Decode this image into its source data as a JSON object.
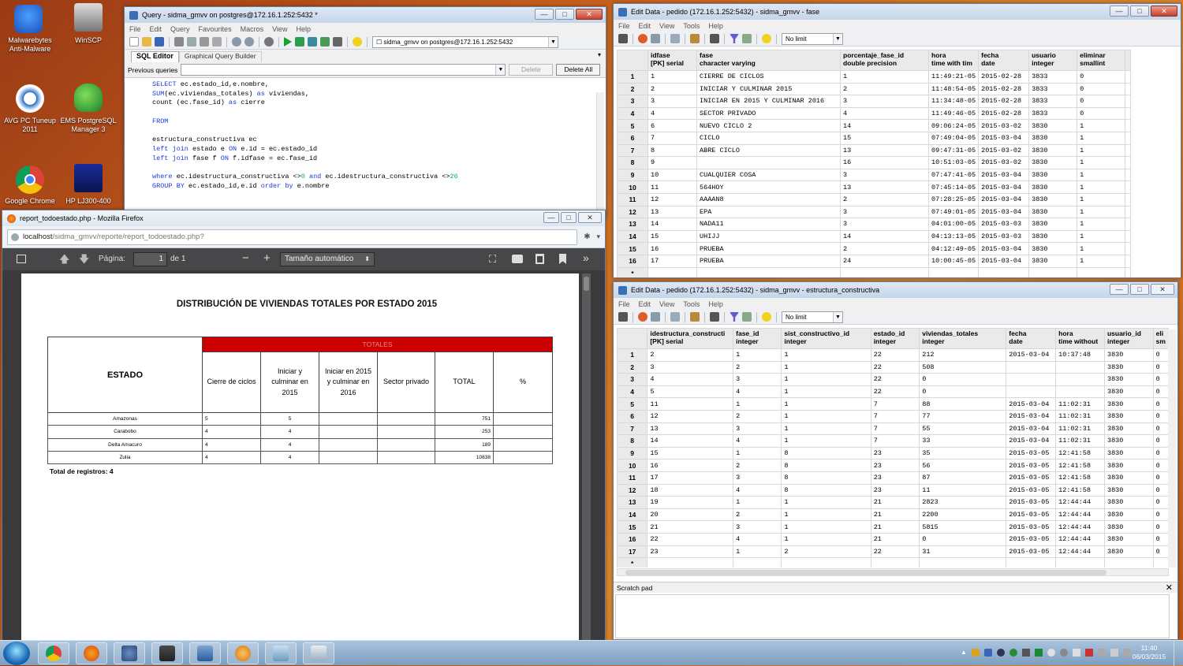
{
  "desktop": {
    "icons": [
      {
        "label": "Malwarebytes Anti-Malware",
        "icon": "malwarebytes-icon"
      },
      {
        "label": "WinSCP",
        "icon": "winscp-icon"
      },
      {
        "label": "AVG PC Tuneup 2011",
        "icon": "avg-icon"
      },
      {
        "label": "EMS PostgreSQL Manager 3",
        "icon": "ems-icon"
      },
      {
        "label": "Google Chrome",
        "icon": "chrome-icon"
      },
      {
        "label": "HP LJ300-400",
        "icon": "printer-icon"
      }
    ]
  },
  "query_window": {
    "title": "Query - sidma_gmvv on postgres@172.16.1.252:5432 *",
    "menu": [
      "File",
      "Edit",
      "Query",
      "Favourites",
      "Macros",
      "View",
      "Help"
    ],
    "connection": "sidma_gmvv on postgres@172.16.1.252:5432",
    "tabs": [
      "SQL Editor",
      "Graphical Query Builder"
    ],
    "previous_queries_label": "Previous queries",
    "delete_label": "Delete",
    "delete_all_label": "Delete All",
    "sql_lines": [
      [
        {
          "t": "SELECT ",
          "c": "kw"
        },
        {
          "t": "ec.estado_id,e.nombre,"
        }
      ],
      [
        {
          "t": "SUM",
          "c": "kw"
        },
        {
          "t": "(ec.viviendas_totales) "
        },
        {
          "t": "as",
          "c": "kw"
        },
        {
          "t": " viviendas,"
        }
      ],
      [
        {
          "t": "count (ec.fase_id) "
        },
        {
          "t": "as",
          "c": "kw"
        },
        {
          "t": " cierre"
        }
      ],
      [
        {
          "t": ""
        }
      ],
      [
        {
          "t": "FROM",
          "c": "kw"
        }
      ],
      [
        {
          "t": ""
        }
      ],
      [
        {
          "t": "estructura_constructiva ec"
        }
      ],
      [
        {
          "t": "left join",
          "c": "kw"
        },
        {
          "t": " estado e "
        },
        {
          "t": "ON",
          "c": "kw"
        },
        {
          "t": " e.id = ec.estado_id"
        }
      ],
      [
        {
          "t": "left join",
          "c": "kw"
        },
        {
          "t": " fase f "
        },
        {
          "t": "ON",
          "c": "kw"
        },
        {
          "t": " f.idfase = ec.fase_id"
        }
      ],
      [
        {
          "t": ""
        }
      ],
      [
        {
          "t": "where",
          "c": "kw"
        },
        {
          "t": " ec.idestructura_constructiva <>"
        },
        {
          "t": "0",
          "c": "num"
        },
        {
          "t": " "
        },
        {
          "t": "and",
          "c": "kw"
        },
        {
          "t": " ec.idestructura_constructiva <>"
        },
        {
          "t": "26",
          "c": "num"
        }
      ],
      [
        {
          "t": "GROUP BY",
          "c": "kw"
        },
        {
          "t": " ec.estado_id,e.id "
        },
        {
          "t": "order by",
          "c": "kw"
        },
        {
          "t": " e.nombre"
        }
      ]
    ]
  },
  "firefox": {
    "title": "report_todoestado.php - Mozilla Firefox",
    "url_host": "localhost",
    "url_path": "/sidma_gmvv/reporte/report_todoestado.php?",
    "page_label": "Página:",
    "page_value": "1",
    "page_of": "de 1",
    "zoom": "Tamaño automático",
    "report": {
      "title": "DISTRIBUCIÓN DE VIVIENDAS TOTALES POR ESTADO 2015",
      "estado_header": "ESTADO",
      "totales_header": "TOTALES",
      "columns": [
        "Cierre de ciclos",
        "Iniciar y culminar en 2015",
        "Iniciar en 2015 y culminar en 2016",
        "Sector privado",
        "TOTAL",
        "%"
      ],
      "rows": [
        {
          "estado": "Amazonas",
          "cierre": "5",
          "iniciar": "5",
          "i2016": "",
          "privado": "",
          "total": "751",
          "pct": ""
        },
        {
          "estado": "Carabobo",
          "cierre": "4",
          "iniciar": "4",
          "i2016": "",
          "privado": "",
          "total": "253",
          "pct": ""
        },
        {
          "estado": "Delta Amacuro",
          "cierre": "4",
          "iniciar": "4",
          "i2016": "",
          "privado": "",
          "total": "189",
          "pct": ""
        },
        {
          "estado": "Zulia",
          "cierre": "4",
          "iniciar": "4",
          "i2016": "",
          "privado": "",
          "total": "10838",
          "pct": ""
        }
      ],
      "footer": "Total de registros: 4"
    }
  },
  "fase_window": {
    "title": "Edit Data - pedido (172.16.1.252:5432) - sidma_gmvv - fase",
    "menu": [
      "File",
      "Edit",
      "View",
      "Tools",
      "Help"
    ],
    "limit": "No limit",
    "headers": [
      [
        "idfase",
        "[PK] serial"
      ],
      [
        "fase",
        "character varying"
      ],
      [
        "porcentaje_fase_id",
        "double precision"
      ],
      [
        "hora",
        "time with tim"
      ],
      [
        "fecha",
        "date"
      ],
      [
        "usuario",
        "integer"
      ],
      [
        "eliminar",
        "smallint"
      ]
    ],
    "rows": [
      [
        "1",
        "CIERRE DE CICLOS",
        "1",
        "11:49:21-05",
        "2015-02-28",
        "3833",
        "0"
      ],
      [
        "2",
        "INICIAR Y CULMINAR 2015",
        "2",
        "11:48:54-05",
        "2015-02-28",
        "3833",
        "0"
      ],
      [
        "3",
        "INICIAR EN 2015 Y CULMINAR 2016",
        "3",
        "11:34:48-05",
        "2015-02-28",
        "3833",
        "0"
      ],
      [
        "4",
        "SECTOR PRIVADO",
        "4",
        "11:49:46-05",
        "2015-02-28",
        "3833",
        "0"
      ],
      [
        "6",
        "NUEVO CICLO 2",
        "14",
        "09:06:24-05",
        "2015-03-02",
        "3830",
        "1"
      ],
      [
        "7",
        "CICLO",
        "15",
        "07:49:04-05",
        "2015-03-04",
        "3830",
        "1"
      ],
      [
        "8",
        "ABRE CICLO",
        "13",
        "09:47:31-05",
        "2015-03-02",
        "3830",
        "1"
      ],
      [
        "9",
        "",
        "16",
        "10:51:03-05",
        "2015-03-02",
        "3830",
        "1"
      ],
      [
        "10",
        "CUALQUIER COSA",
        "3",
        "07:47:41-05",
        "2015-03-04",
        "3830",
        "1"
      ],
      [
        "11",
        "564HOY",
        "13",
        "07:45:14-05",
        "2015-03-04",
        "3830",
        "1"
      ],
      [
        "12",
        "AAAAN8",
        "2",
        "07:28:25-05",
        "2015-03-04",
        "3830",
        "1"
      ],
      [
        "13",
        "EPA",
        "3",
        "07:49:01-05",
        "2015-03-04",
        "3830",
        "1"
      ],
      [
        "14",
        "NADA11",
        "3",
        "04:01:00-05",
        "2015-03-03",
        "3830",
        "1"
      ],
      [
        "15",
        "UHIJJ",
        "14",
        "04:13:13-05",
        "2015-03-03",
        "3830",
        "1"
      ],
      [
        "16",
        "PRUEBA",
        "2",
        "04:12:49-05",
        "2015-03-04",
        "3830",
        "1"
      ],
      [
        "17",
        "PRUEBA",
        "24",
        "10:00:45-05",
        "2015-03-04",
        "3830",
        "1"
      ]
    ],
    "new_row_marker": "*"
  },
  "estructura_window": {
    "title": "Edit Data - pedido (172.16.1.252:5432) - sidma_gmvv - estructura_constructiva",
    "menu": [
      "File",
      "Edit",
      "View",
      "Tools",
      "Help"
    ],
    "limit": "No limit",
    "headers": [
      [
        "idestructura_constructi",
        "[PK] serial"
      ],
      [
        "fase_id",
        "integer"
      ],
      [
        "sist_constructivo_id",
        "integer"
      ],
      [
        "estado_id",
        "integer"
      ],
      [
        "viviendas_totales",
        "integer"
      ],
      [
        "fecha",
        "date"
      ],
      [
        "hora",
        "time without"
      ],
      [
        "usuario_id",
        "integer"
      ],
      [
        "eli",
        "sm"
      ]
    ],
    "rows": [
      [
        "2",
        "1",
        "1",
        "22",
        "212",
        "2015-03-04",
        "10:37:48",
        "3830",
        "0"
      ],
      [
        "3",
        "2",
        "1",
        "22",
        "508",
        "",
        "",
        "3830",
        "0"
      ],
      [
        "4",
        "3",
        "1",
        "22",
        "0",
        "",
        "",
        "3830",
        "0"
      ],
      [
        "5",
        "4",
        "1",
        "22",
        "0",
        "",
        "",
        "3830",
        "0"
      ],
      [
        "11",
        "1",
        "1",
        "7",
        "88",
        "2015-03-04",
        "11:02:31",
        "3830",
        "0"
      ],
      [
        "12",
        "2",
        "1",
        "7",
        "77",
        "2015-03-04",
        "11:02:31",
        "3830",
        "0"
      ],
      [
        "13",
        "3",
        "1",
        "7",
        "55",
        "2015-03-04",
        "11:02:31",
        "3830",
        "0"
      ],
      [
        "14",
        "4",
        "1",
        "7",
        "33",
        "2015-03-04",
        "11:02:31",
        "3830",
        "0"
      ],
      [
        "15",
        "1",
        "8",
        "23",
        "35",
        "2015-03-05",
        "12:41:58",
        "3830",
        "0"
      ],
      [
        "16",
        "2",
        "8",
        "23",
        "56",
        "2015-03-05",
        "12:41:58",
        "3830",
        "0"
      ],
      [
        "17",
        "3",
        "8",
        "23",
        "87",
        "2015-03-05",
        "12:41:58",
        "3830",
        "0"
      ],
      [
        "18",
        "4",
        "8",
        "23",
        "11",
        "2015-03-05",
        "12:41:58",
        "3830",
        "0"
      ],
      [
        "19",
        "1",
        "1",
        "21",
        "2823",
        "2015-03-05",
        "12:44:44",
        "3830",
        "0"
      ],
      [
        "20",
        "2",
        "1",
        "21",
        "2200",
        "2015-03-05",
        "12:44:44",
        "3830",
        "0"
      ],
      [
        "21",
        "3",
        "1",
        "21",
        "5815",
        "2015-03-05",
        "12:44:44",
        "3830",
        "0"
      ],
      [
        "22",
        "4",
        "1",
        "21",
        "0",
        "2015-03-05",
        "12:44:44",
        "3830",
        "0"
      ],
      [
        "23",
        "1",
        "2",
        "22",
        "31",
        "2015-03-05",
        "12:44:44",
        "3830",
        "0"
      ]
    ],
    "new_row_marker": "*",
    "scratch_pad": "Scratch pad"
  },
  "taskbar": {
    "time": "11:40",
    "date": "06/03/2015",
    "apps": [
      "chrome-icon",
      "firefox-icon",
      "pgadmin-icon",
      "sublime-icon",
      "remote-icon",
      "media-icon",
      "window-icon",
      "calculator-icon"
    ]
  },
  "colors": {
    "report_header_red": "#cc0000",
    "sql_keyword": "#1a3cd6",
    "sql_number": "#0a9a9a"
  }
}
